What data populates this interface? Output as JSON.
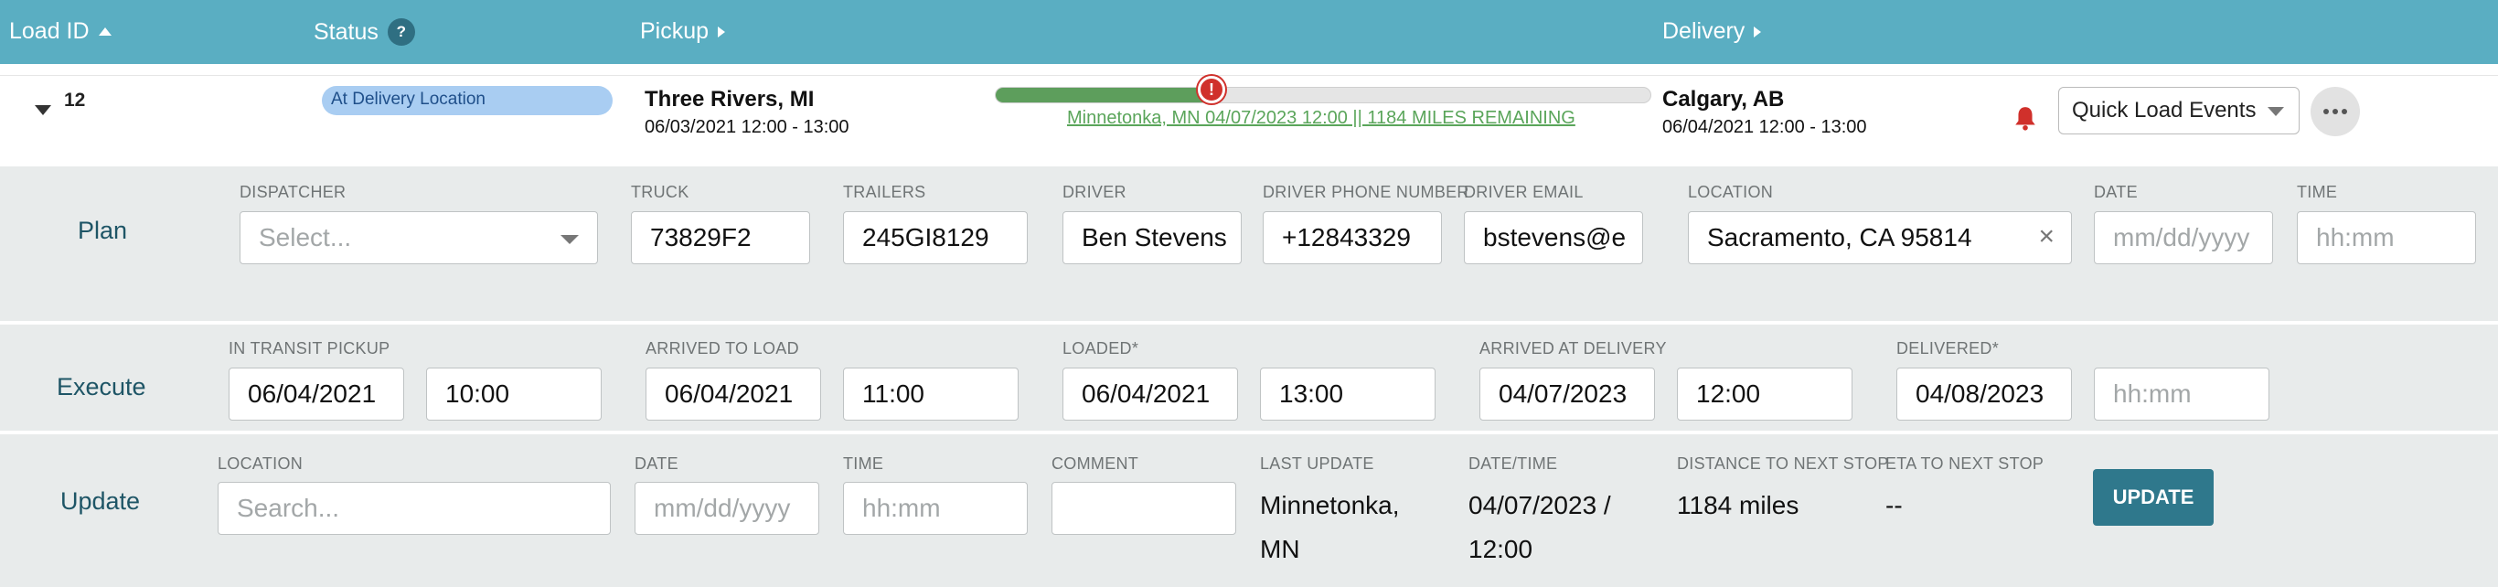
{
  "header": {
    "load_id": "Load ID",
    "status": "Status",
    "status_help": "?",
    "pickup": "Pickup",
    "delivery": "Delivery"
  },
  "load": {
    "id": "12",
    "status_badge": "At Delivery Location",
    "pickup": {
      "city": "Three Rivers, MI",
      "window": "06/03/2021 12:00 - 13:00"
    },
    "delivery": {
      "city": "Calgary, AB",
      "window": "06/04/2021 12:00 - 13:00"
    },
    "progress": {
      "fraction": 0.33,
      "alert": "!",
      "text": "Minnetonka, MN 04/07/2023 12:00 || 1184 MILES REMAINING"
    },
    "quick_events_label": "Quick Load Events"
  },
  "plan": {
    "label": "Plan",
    "fields": {
      "dispatcher": {
        "label": "DISPATCHER",
        "placeholder": "Select..."
      },
      "truck": {
        "label": "TRUCK",
        "value": "73829F2"
      },
      "trailers": {
        "label": "TRAILERS",
        "value": "245GI8129"
      },
      "driver": {
        "label": "DRIVER",
        "value": "Ben Stevens"
      },
      "driver_phone": {
        "label": "DRIVER PHONE NUMBER",
        "value": "+12843329"
      },
      "driver_email": {
        "label": "DRIVER EMAIL",
        "value": "bstevens@e"
      },
      "location": {
        "label": "LOCATION",
        "value": "Sacramento, CA 95814"
      },
      "date": {
        "label": "DATE",
        "placeholder": "mm/dd/yyyy"
      },
      "time": {
        "label": "TIME",
        "placeholder": "hh:mm"
      }
    }
  },
  "execute": {
    "label": "Execute",
    "fields": {
      "in_transit_pickup": {
        "label": "IN TRANSIT PICKUP",
        "date": "06/04/2021",
        "time": "10:00"
      },
      "arrived_to_load": {
        "label": "ARRIVED TO LOAD",
        "date": "06/04/2021",
        "time": "11:00"
      },
      "loaded": {
        "label": "LOADED*",
        "date": "06/04/2021",
        "time": "13:00"
      },
      "arrived_at_delivery": {
        "label": "ARRIVED AT DELIVERY",
        "date": "04/07/2023",
        "time": "12:00"
      },
      "delivered": {
        "label": "DELIVERED*",
        "date": "04/08/2023",
        "time_placeholder": "hh:mm"
      }
    }
  },
  "update": {
    "label": "Update",
    "fields": {
      "location": {
        "label": "LOCATION",
        "placeholder": "Search..."
      },
      "date": {
        "label": "DATE",
        "placeholder": "mm/dd/yyyy"
      },
      "time": {
        "label": "TIME",
        "placeholder": "hh:mm"
      },
      "comment": {
        "label": "COMMENT",
        "value": ""
      },
      "last_update": {
        "label": "LAST UPDATE",
        "line1": "Minnetonka,",
        "line2": "MN"
      },
      "datetime": {
        "label": "DATE/TIME",
        "line1": "04/07/2023 /",
        "line2": "12:00"
      },
      "distance": {
        "label": "DISTANCE TO NEXT STOP",
        "value": "1184 miles"
      },
      "eta": {
        "label": "ETA TO NEXT STOP",
        "value": "--"
      }
    },
    "button_label": "UPDATE"
  },
  "colors": {
    "header": "#5aaec2",
    "badge": "#a9cdf2",
    "progress": "#5d9e5c",
    "alert": "#d0302b",
    "section": "#e8ebeb",
    "button": "#2f788c"
  }
}
